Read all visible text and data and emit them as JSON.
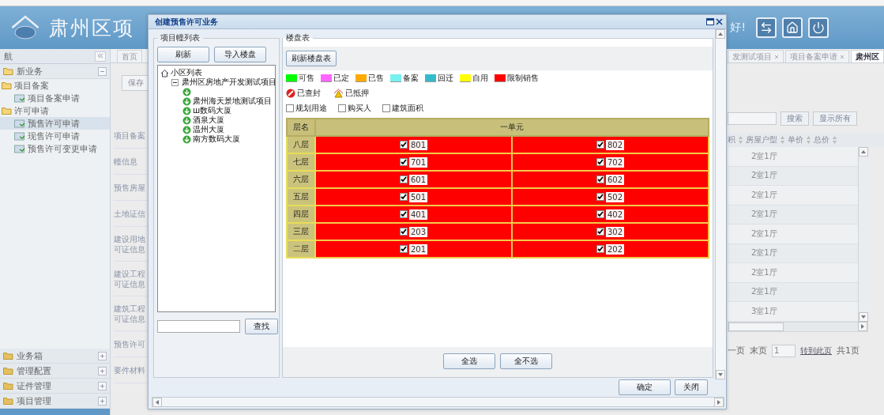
{
  "header": {
    "title": "肃州区项",
    "greeting": "好!"
  },
  "nav": {
    "title": "航",
    "groups": [
      {
        "label": "新业务",
        "expanded": true,
        "children": [
          {
            "label": "项目备案",
            "expanded": true,
            "children": [
              {
                "label": "项目备案申请",
                "selected": false
              }
            ]
          },
          {
            "label": "许可申请",
            "expanded": true,
            "children": [
              {
                "label": "预售许可申请",
                "selected": true
              },
              {
                "label": "现售许可申请",
                "selected": false
              },
              {
                "label": "预售许可变更申请",
                "selected": false
              }
            ]
          }
        ]
      },
      {
        "label": "业务箱",
        "expanded": false
      },
      {
        "label": "管理配置",
        "expanded": false
      },
      {
        "label": "证件管理",
        "expanded": false
      },
      {
        "label": "项目管理",
        "expanded": false
      }
    ]
  },
  "tabs": [
    {
      "label": "首页",
      "selected": false,
      "closable": false
    },
    {
      "label": "发测试项目",
      "selected": false,
      "closable": true
    },
    {
      "label": "项目备案申请",
      "selected": false,
      "closable": true
    },
    {
      "label": "肃州区",
      "selected": true,
      "closable": false
    }
  ],
  "form": {
    "save_button": "保存",
    "labels": [
      [
        "项目备案"
      ],
      [
        "幢信息"
      ],
      [
        "预售房屋"
      ],
      [
        "土地证信"
      ],
      [
        "建设用地",
        "可证信息"
      ],
      [
        "建设工程",
        "可证信息"
      ],
      [
        "建筑工程",
        "可证信息"
      ],
      [
        "预售许可"
      ],
      [
        "要件材料"
      ]
    ]
  },
  "grid": {
    "search_buttons": [
      "搜索",
      "显示所有"
    ],
    "columns": [
      "积",
      "房屋户型",
      "单价",
      "总价"
    ],
    "rows": [
      {
        "layout": "2室1厅"
      },
      {
        "layout": "2室1厅"
      },
      {
        "layout": "2室1厅"
      },
      {
        "layout": "2室1厅"
      },
      {
        "layout": "2室1厅"
      },
      {
        "layout": "2室1厅"
      },
      {
        "layout": "2室1厅"
      },
      {
        "layout": "2室1厅"
      },
      {
        "layout": "3室1厅"
      }
    ],
    "pager": {
      "prev": "一页",
      "last": "末页",
      "page_value": "1",
      "goto": "转到此页",
      "total": "共1页"
    }
  },
  "dialog": {
    "title": "创建预售许可业务",
    "project_panel": {
      "title": "项目幢列表",
      "buttons": [
        "刷新",
        "导入楼盘"
      ],
      "search_button": "查找",
      "tree": {
        "label": "小区列表",
        "children": [
          {
            "label": "肃州区房地产开发测试项目",
            "expanded": true,
            "children": [
              {
                "kind": "building"
              },
              {
                "kind": "building",
                "label": "肃州海天景地测试项目"
              },
              {
                "kind": "building",
                "label": "ш数码大厦"
              },
              {
                "kind": "building",
                "label": "酒泉大厦"
              },
              {
                "kind": "building",
                "label": "温州大厦"
              },
              {
                "kind": "building",
                "label": "南方数码大厦"
              }
            ]
          }
        ]
      }
    },
    "building_panel": {
      "title": "楼盘表",
      "refresh_button": "刷新楼盘表",
      "legend": [
        {
          "label": "可售",
          "color": "#00ff00"
        },
        {
          "label": "已定",
          "color": "#ff66ff"
        },
        {
          "label": "已售",
          "color": "#ffaa00"
        },
        {
          "label": "备案",
          "color": "#77f0f0"
        },
        {
          "label": "回迁",
          "color": "#33bbcc"
        },
        {
          "label": "自用",
          "color": "#ffff00"
        },
        {
          "label": "限制销售",
          "color": "#ff0000"
        }
      ],
      "markers": [
        {
          "kind": "sealed",
          "label": "已查封"
        },
        {
          "kind": "mortgaged",
          "label": "已抵押"
        }
      ],
      "filters": [
        {
          "label": "规划用途",
          "checked": false
        },
        {
          "label": "购买人",
          "checked": false
        },
        {
          "label": "建筑面积",
          "checked": false
        }
      ],
      "table": {
        "floor_header": "层名",
        "unit_header": "一单元",
        "floors": [
          {
            "name": "八层",
            "rooms": [
              {
                "number": "801",
                "checked": true,
                "color": "#ff0000"
              },
              {
                "number": "802",
                "checked": true,
                "color": "#ff0000"
              }
            ]
          },
          {
            "name": "七层",
            "rooms": [
              {
                "number": "701",
                "checked": true,
                "color": "#ff0000"
              },
              {
                "number": "702",
                "checked": true,
                "color": "#ff0000"
              }
            ]
          },
          {
            "name": "六层",
            "rooms": [
              {
                "number": "601",
                "checked": true,
                "color": "#ff0000"
              },
              {
                "number": "602",
                "checked": true,
                "color": "#ff0000"
              }
            ]
          },
          {
            "name": "五层",
            "rooms": [
              {
                "number": "501",
                "checked": true,
                "color": "#ff0000"
              },
              {
                "number": "502",
                "checked": true,
                "color": "#ff0000"
              }
            ]
          },
          {
            "name": "四层",
            "rooms": [
              {
                "number": "401",
                "checked": true,
                "color": "#ff0000"
              },
              {
                "number": "402",
                "checked": true,
                "color": "#ff0000"
              }
            ]
          },
          {
            "name": "三层",
            "rooms": [
              {
                "number": "203",
                "checked": true,
                "color": "#ff0000"
              },
              {
                "number": "302",
                "checked": true,
                "color": "#ff0000"
              }
            ]
          },
          {
            "name": "二层",
            "rooms": [
              {
                "number": "201",
                "checked": true,
                "color": "#ff0000"
              },
              {
                "number": "202",
                "checked": true,
                "color": "#ff0000"
              }
            ]
          }
        ]
      },
      "buttons": [
        "全选",
        "全不选"
      ]
    },
    "footer_buttons": [
      "确定",
      "关闭"
    ]
  }
}
